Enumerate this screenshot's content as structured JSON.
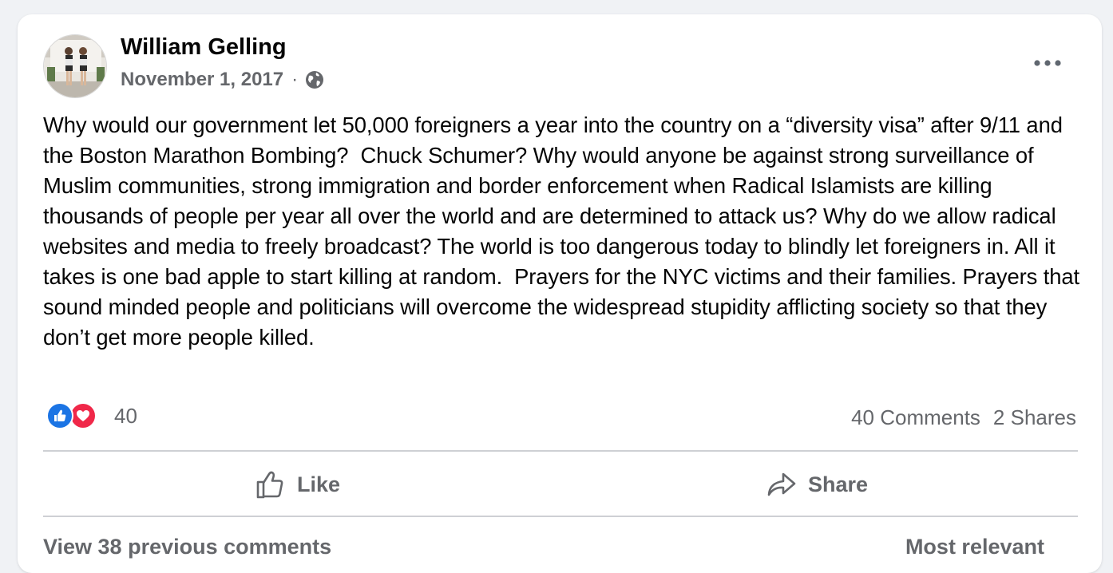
{
  "post": {
    "author": "William Gelling",
    "date": "November 1, 2017",
    "separator": "·",
    "privacy_icon": "globe-icon",
    "text": "Why would our government let 50,000 foreigners a year into the country on a “diversity visa” after 9/11 and the Boston Marathon Bombing?  Chuck Schumer? Why would anyone be against strong surveillance of Muslim communities, strong immigration and border enforcement when Radical Islamists are killing thousands of people per year all over the world and are determined to attack us? Why do we allow radical websites and media to freely broadcast? The world is too dangerous today to blindly let foreigners in. All it takes is one bad apple to start killing at random.  Prayers for the NYC victims and their families. Prayers that sound minded people and politicians will overcome the widespread stupidity afflicting society so that they don’t get more people killed."
  },
  "engagement": {
    "reaction_count": "40",
    "comments": "40 Comments",
    "shares": "2 Shares"
  },
  "actions": {
    "like": "Like",
    "share": "Share"
  },
  "comments_bar": {
    "view_more": "View 38 previous comments",
    "sort": "Most relevant"
  },
  "colors": {
    "like_blue": "#1b74e4",
    "love_red": "#f02849",
    "secondary_text": "#65676b"
  }
}
